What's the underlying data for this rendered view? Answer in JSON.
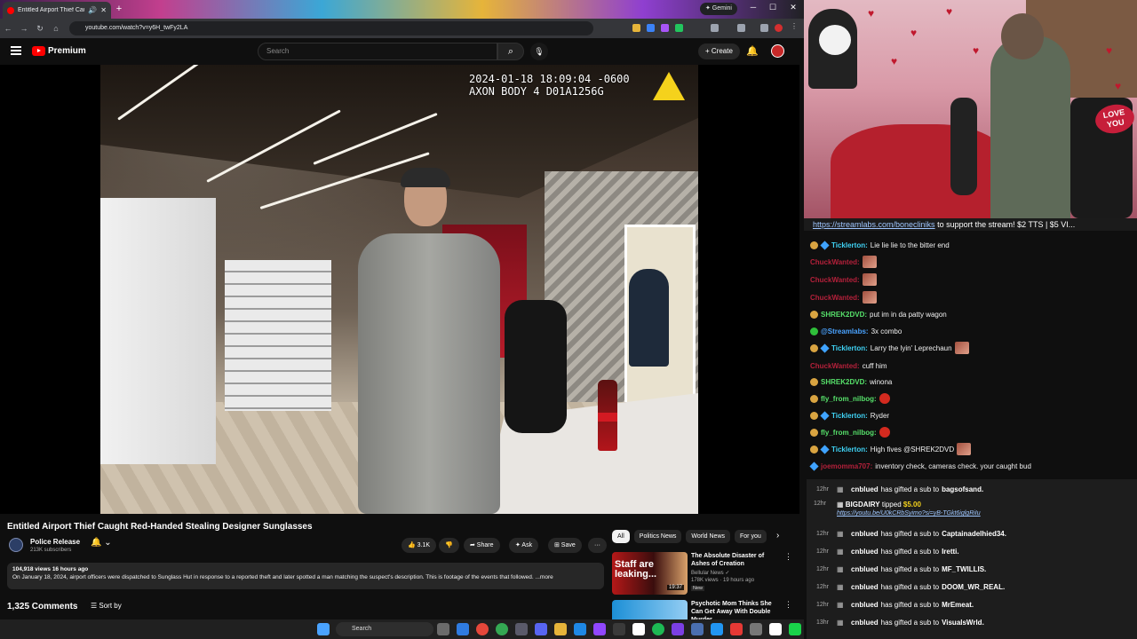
{
  "browser": {
    "tab_title": "Entitled Airport Thief Caught",
    "new_tab": "+",
    "gemini_label": "✦ Gemini",
    "url": "youtube.com/watch?v=y6H_twFy2LA",
    "window_controls": [
      "─",
      "☐",
      "✕"
    ]
  },
  "youtube": {
    "logo_text": "Premium",
    "search_placeholder": "Search",
    "create_label": "+ Create",
    "osd_line1": "2024-01-18 18:09:04 -0600",
    "osd_line2": "AXON BODY 4 D01A1256G",
    "video_title": "Entitled Airport Thief Caught Red-Handed Stealing Designer Sunglasses",
    "channel_name": "Police Release",
    "channel_subs": "213K subscribers",
    "like_count": "👍 3.1K",
    "dislike": "👎",
    "share_label": "➦ Share",
    "ask_label": "✦ Ask",
    "save_label": "⊞ Save",
    "more_label": "···",
    "desc_meta": "104,918 views  16 hours ago",
    "desc_text": "On January 18, 2024, airport officers were dispatched to Sunglass Hut in response to a reported theft and later spotted a man matching the suspect's description. This is footage of the events that followed. ...more",
    "comments_count": "1,325 Comments",
    "sort_label": "☰ Sort by",
    "chips": [
      "All",
      "Politics News",
      "World News",
      "For you"
    ],
    "recommendations": [
      {
        "thumb_text": "Staff are leaking...",
        "duration": "19:37",
        "title": "The Absolute Disaster of Ashes of Creation",
        "channel": "Bellular News ✓",
        "meta": "178K views · 19 hours ago",
        "badge": "New"
      },
      {
        "title": "Psychotic Mom Thinks She Can Get Away With Double Murder"
      }
    ]
  },
  "stream": {
    "love_sign": "LOVE YOU",
    "ticker_link": "https://streamlabs.com/bonecliniks",
    "ticker_text": " to support the stream! $2 TTS | $5 VI...",
    "chat": [
      {
        "name": "Ticklerton:",
        "name_color": "#3fd2f4",
        "text": "Lie lie lie to the bitter end",
        "badges": [
          "coin",
          "sub"
        ]
      },
      {
        "name": "ChuckWanted:",
        "name_color": "#b3203a",
        "text": "",
        "emote": true
      },
      {
        "name": "ChuckWanted:",
        "name_color": "#b3203a",
        "text": "",
        "emote": true
      },
      {
        "name": "ChuckWanted:",
        "name_color": "#b3203a",
        "text": "",
        "emote": true
      },
      {
        "name": "SHREK2DVD:",
        "name_color": "#56e06a",
        "text": "put im in da patty wagon",
        "badges": [
          "coin"
        ]
      },
      {
        "name": "@Streamlabs:",
        "name_color": "#4aa3ff",
        "text": "3x   combo",
        "badges": [
          "green"
        ],
        "emote_mid": true
      },
      {
        "name": "Ticklerton:",
        "name_color": "#3fd2f4",
        "text": "Larry the lyin' Leprechaun",
        "badges": [
          "coin",
          "sub"
        ],
        "emote_end": true
      },
      {
        "name": "ChuckWanted:",
        "name_color": "#b3203a",
        "text": "cuff him"
      },
      {
        "name": "SHREK2DVD:",
        "name_color": "#56e06a",
        "text": "winona",
        "badges": [
          "coin"
        ]
      },
      {
        "name": "fly_from_nilbog:",
        "name_color": "#56e06a",
        "text": "",
        "badges": [
          "coin"
        ],
        "red_emote": true
      },
      {
        "name": "Ticklerton:",
        "name_color": "#3fd2f4",
        "text": "Ryder",
        "badges": [
          "coin",
          "sub"
        ]
      },
      {
        "name": "fly_from_nilbog:",
        "name_color": "#56e06a",
        "text": "",
        "badges": [
          "coin"
        ],
        "red_emote": true
      },
      {
        "name": "Ticklerton:",
        "name_color": "#3fd2f4",
        "text": "High fives @SHREK2DVD",
        "badges": [
          "coin",
          "sub"
        ],
        "emote_end": true
      },
      {
        "name": "joemomma707:",
        "name_color": "#b3203a",
        "text": "inventory check, cameras check. your caught bud",
        "badges": [
          "sub"
        ]
      }
    ],
    "events": [
      {
        "time": "12hr",
        "user": "cnblued",
        "action": "has gifted a sub to",
        "target": "bagsofsand."
      },
      {
        "time": "12hr",
        "user": "BIGDAIRY",
        "action": "tipped",
        "amount": "$5.00",
        "link": "https://youtu.be/U0kCRbSyimo?si=yB-TGkt6iglgRiIu",
        "tip": true
      },
      {
        "time": "12hr",
        "user": "cnblued",
        "action": "has gifted a sub to",
        "target": "Captainadelhied34."
      },
      {
        "time": "12hr",
        "user": "cnblued",
        "action": "has gifted a sub to",
        "target": "Iretti."
      },
      {
        "time": "12hr",
        "user": "cnblued",
        "action": "has gifted a sub to",
        "target": "MF_TWILLIS."
      },
      {
        "time": "12hr",
        "user": "cnblued",
        "action": "has gifted a sub to",
        "target": "DOOM_WR_REAL."
      },
      {
        "time": "12hr",
        "user": "cnblued",
        "action": "has gifted a sub to",
        "target": "MrEmeat."
      },
      {
        "time": "13hr",
        "user": "cnblued",
        "action": "has gifted a sub to",
        "target": "VisualsWrld."
      }
    ]
  },
  "taskbar": {
    "search_label": "Search"
  }
}
